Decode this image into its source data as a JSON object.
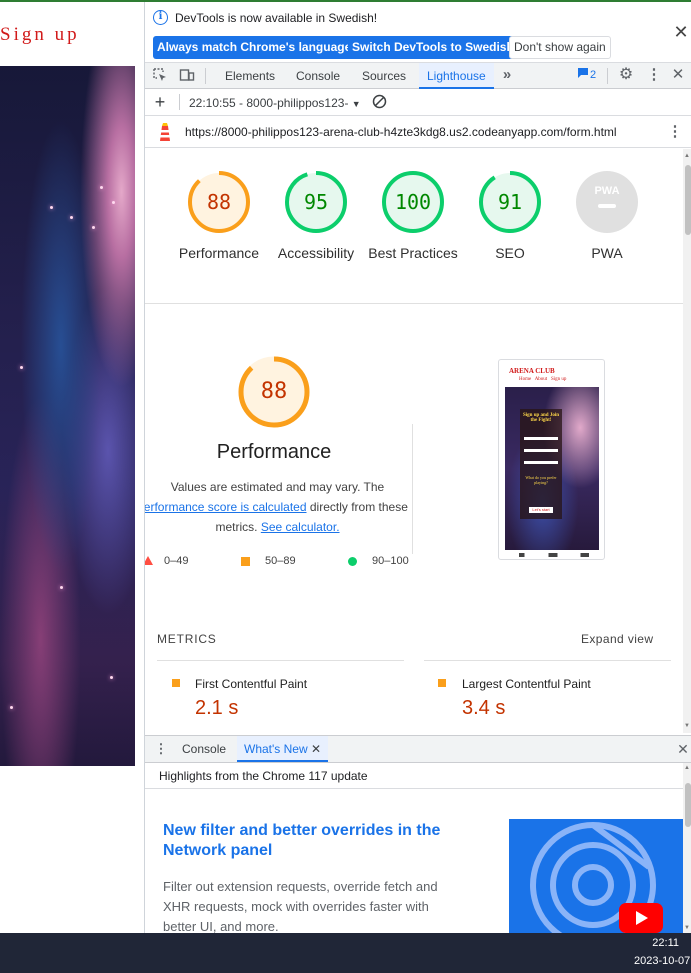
{
  "site": {
    "nav_signup": "Sign up"
  },
  "devtools": {
    "infobar": {
      "message": "DevTools is now available in Swedish!",
      "btn_match": "Always match Chrome's language",
      "btn_switch": "Switch DevTools to Swedish",
      "btn_dont_show": "Don't show again"
    },
    "tabs": [
      "Elements",
      "Console",
      "Sources",
      "Lighthouse"
    ],
    "active_tab": "Lighthouse",
    "issues_count": "2",
    "lighthouse_report_select": "22:10:55 - 8000-philippos123-",
    "url": "https://8000-philippos123-arena-club-h4zte3kdg8.us2.codeanyapp.com/form.html"
  },
  "scores": [
    {
      "label": "Performance",
      "value": "88",
      "color": "#fa9f1b"
    },
    {
      "label": "Accessibility",
      "value": "95",
      "color": "#0cce6b"
    },
    {
      "label": "Best Practices",
      "value": "100",
      "color": "#0cce6b"
    },
    {
      "label": "SEO",
      "value": "91",
      "color": "#0cce6b"
    },
    {
      "label": "PWA",
      "value": "PWA",
      "color": "#9e9e9e"
    }
  ],
  "performance": {
    "score": "88",
    "title": "Performance",
    "desc_1": "Values are estimated and may vary. The",
    "desc_link": "performance score is calculated",
    "desc_2": "directly from these",
    "desc_3": "metrics.",
    "calc_link": "See calculator.",
    "legend": [
      "0–49",
      "50–89",
      "90–100"
    ]
  },
  "thumbnail": {
    "title": "ARENA CLUB",
    "nav": "Home   About   Sign up",
    "form_title": "Sign up and Join the Fight!",
    "question": "What do you prefer playing?",
    "btn": "Let's start"
  },
  "metrics": {
    "heading": "METRICS",
    "expand": "Expand view",
    "items": [
      {
        "name": "First Contentful Paint",
        "value": "2.1 s"
      },
      {
        "name": "Largest Contentful Paint",
        "value": "3.4 s"
      }
    ]
  },
  "drawer": {
    "tabs": [
      "Console",
      "What's New"
    ],
    "highlights": "Highlights from the Chrome 117 update",
    "article_title": "New filter and better overrides in the Network panel",
    "article_body": "Filter out extension requests, override fetch and XHR requests, mock with overrides faster with better UI, and more."
  },
  "taskbar": {
    "time": "22:11",
    "date": "2023-10-07"
  }
}
